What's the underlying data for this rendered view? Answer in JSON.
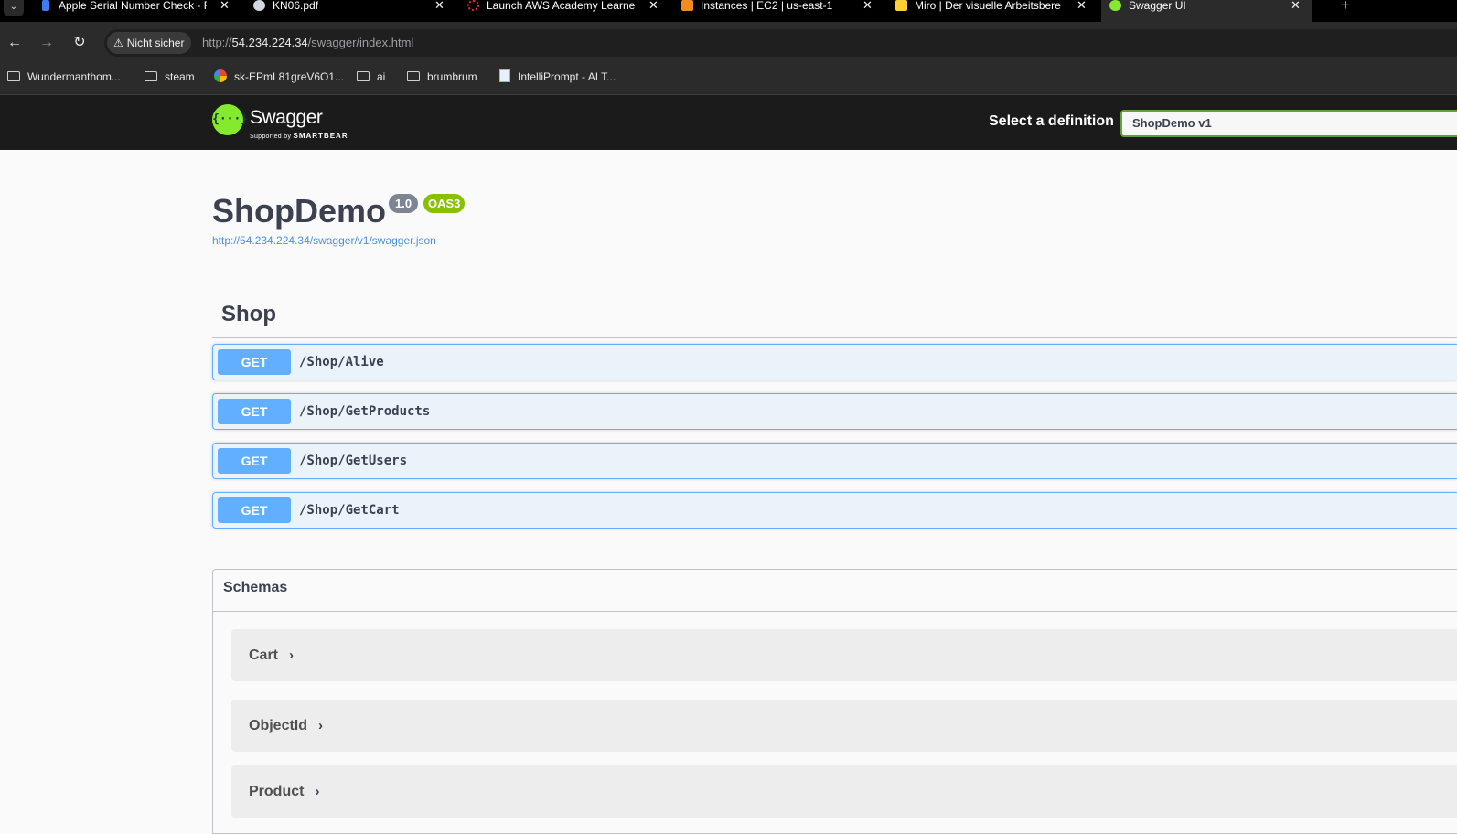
{
  "browser": {
    "tabs": [
      {
        "title": "Apple Serial Number Check - F",
        "favicon_color": "#3d7cf3",
        "active": false
      },
      {
        "title": "KN06.pdf",
        "favicon_color": "#cfd8e3",
        "active": false
      },
      {
        "title": "Launch AWS Academy Learner",
        "favicon_color": "#d93025",
        "active": false
      },
      {
        "title": "Instances | EC2 | us-east-1",
        "favicon_color": "#f28b21",
        "active": false
      },
      {
        "title": "Miro | Der visuelle Arbeitsbere",
        "favicon_color": "#ffd02f",
        "active": false
      },
      {
        "title": "Swagger UI",
        "favicon_color": "#85ea2d",
        "active": true
      }
    ],
    "tab_close_glyph": "✕",
    "new_tab_glyph": "+",
    "security_label": "Nicht sicher",
    "url_prefix": "http://",
    "url_host": "54.234.224.34",
    "url_path": "/swagger/index.html",
    "bookmarks": [
      {
        "label": "Wundermanthom...",
        "icon": "folder-icon"
      },
      {
        "label": "steam",
        "icon": "folder-icon"
      },
      {
        "label": "sk-EPmL81greV6O1...",
        "icon": "google-icon"
      },
      {
        "label": "ai",
        "icon": "folder-icon"
      },
      {
        "label": "brumbrum",
        "icon": "folder-icon"
      },
      {
        "label": "IntelliPrompt - AI T...",
        "icon": "document-icon"
      }
    ]
  },
  "swagger": {
    "logo_text": "Swagger",
    "logo_sub_prefix": "Supported by",
    "logo_sub_brand": "SMARTBEAR",
    "logo_glyph": "{···}",
    "definition_label": "Select a definition",
    "definition_selected": "ShopDemo v1",
    "colors": {
      "accent_green": "#85ea2d",
      "get_blue": "#61affe",
      "oas_green": "#89bf04"
    }
  },
  "info": {
    "title": "ShopDemo",
    "version": "1.0",
    "oas_badge": "OAS3",
    "spec_url": "http://54.234.224.34/swagger/v1/swagger.json"
  },
  "tag": {
    "name": "Shop",
    "operations": [
      {
        "method": "GET",
        "path": "/Shop/Alive"
      },
      {
        "method": "GET",
        "path": "/Shop/GetProducts"
      },
      {
        "method": "GET",
        "path": "/Shop/GetUsers"
      },
      {
        "method": "GET",
        "path": "/Shop/GetCart"
      }
    ]
  },
  "schemas": {
    "title": "Schemas",
    "chevron_glyph": "›",
    "items": [
      "Cart",
      "ObjectId",
      "Product"
    ]
  }
}
